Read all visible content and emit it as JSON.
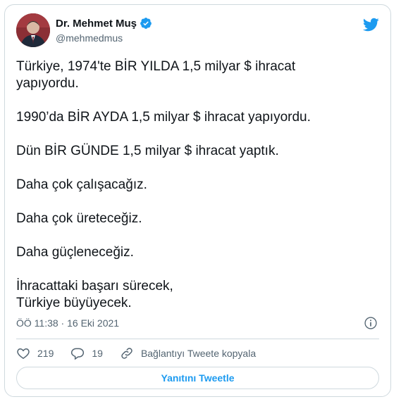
{
  "author": {
    "name": "Dr. Mehmet Muş",
    "handle": "@mehmedmus"
  },
  "tweet": {
    "paragraphs": [
      "Türkiye, 1974'te BİR YILDA 1,5 milyar $ ihracat\nyapıyordu.",
      "1990’da BİR AYDA 1,5 milyar $ ihracat yapıyordu.",
      "Dün BİR GÜNDE 1,5 milyar $ ihracat yaptık.",
      "Daha çok çalışacağız.",
      "Daha çok üreteceğiz.",
      "Daha güçleneceğiz.",
      "İhracattaki başarı sürecek,\nTürkiye büyüyecek."
    ],
    "timestamp": "ÖÖ 11:38 · 16 Eki 2021"
  },
  "actions": {
    "likes": "219",
    "replies": "19",
    "copy_link_label": "Bağlantıyı Tweete kopyala"
  },
  "reply_button": "Yanıtını Tweetle",
  "colors": {
    "accent": "#1d9bf0",
    "muted": "#536471",
    "border": "#cfd9de",
    "like_icon": "#536471"
  },
  "icons": [
    "twitter-bird-icon",
    "verified-badge-icon",
    "info-icon",
    "heart-icon",
    "reply-icon",
    "link-icon"
  ]
}
